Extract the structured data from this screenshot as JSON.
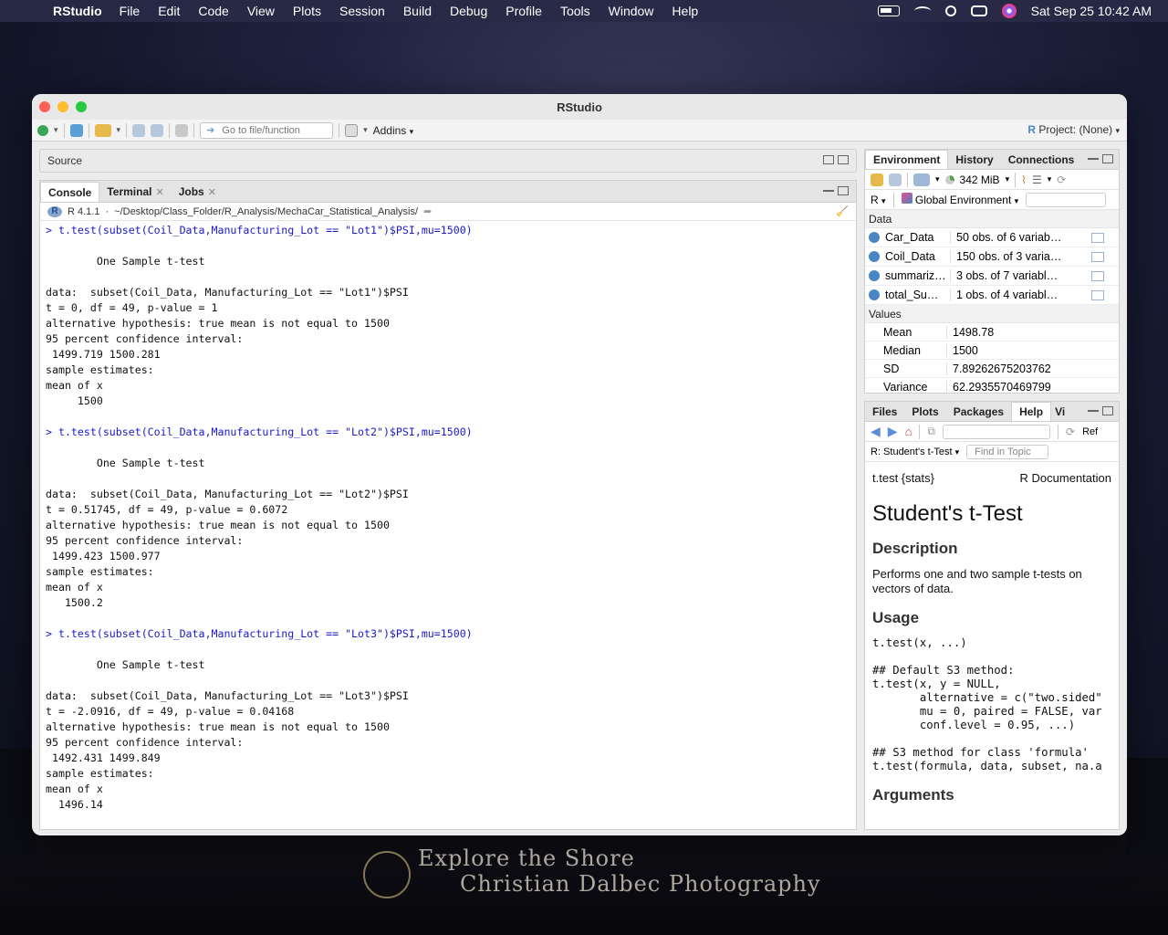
{
  "menubar": {
    "app_name": "RStudio",
    "items": [
      "File",
      "Edit",
      "Code",
      "View",
      "Plots",
      "Session",
      "Build",
      "Debug",
      "Profile",
      "Tools",
      "Window",
      "Help"
    ],
    "datetime": "Sat Sep 25  10:42 AM"
  },
  "window": {
    "title": "RStudio"
  },
  "toolbar": {
    "goto_placeholder": "Go to file/function",
    "addins_label": "Addins",
    "project_label": "Project: (None)"
  },
  "source_pane": {
    "title": "Source"
  },
  "console": {
    "tabs": [
      "Console",
      "Terminal",
      "Jobs"
    ],
    "r_version": "R 4.1.1",
    "path": "~/Desktop/Class_Folder/R_Analysis/MechaCar_Statistical_Analysis/",
    "lines": [
      {
        "t": "cmd",
        "text": "> t.test(subset(Coil_Data,Manufacturing_Lot == \"Lot1\")$PSI,mu=1500)"
      },
      {
        "t": "out",
        "text": ""
      },
      {
        "t": "out",
        "text": "        One Sample t-test"
      },
      {
        "t": "out",
        "text": ""
      },
      {
        "t": "out",
        "text": "data:  subset(Coil_Data, Manufacturing_Lot == \"Lot1\")$PSI"
      },
      {
        "t": "out",
        "text": "t = 0, df = 49, p-value = 1"
      },
      {
        "t": "out",
        "text": "alternative hypothesis: true mean is not equal to 1500"
      },
      {
        "t": "out",
        "text": "95 percent confidence interval:"
      },
      {
        "t": "out",
        "text": " 1499.719 1500.281"
      },
      {
        "t": "out",
        "text": "sample estimates:"
      },
      {
        "t": "out",
        "text": "mean of x"
      },
      {
        "t": "out",
        "text": "     1500"
      },
      {
        "t": "out",
        "text": ""
      },
      {
        "t": "cmd",
        "text": "> t.test(subset(Coil_Data,Manufacturing_Lot == \"Lot2\")$PSI,mu=1500)"
      },
      {
        "t": "out",
        "text": ""
      },
      {
        "t": "out",
        "text": "        One Sample t-test"
      },
      {
        "t": "out",
        "text": ""
      },
      {
        "t": "out",
        "text": "data:  subset(Coil_Data, Manufacturing_Lot == \"Lot2\")$PSI"
      },
      {
        "t": "out",
        "text": "t = 0.51745, df = 49, p-value = 0.6072"
      },
      {
        "t": "out",
        "text": "alternative hypothesis: true mean is not equal to 1500"
      },
      {
        "t": "out",
        "text": "95 percent confidence interval:"
      },
      {
        "t": "out",
        "text": " 1499.423 1500.977"
      },
      {
        "t": "out",
        "text": "sample estimates:"
      },
      {
        "t": "out",
        "text": "mean of x"
      },
      {
        "t": "out",
        "text": "   1500.2"
      },
      {
        "t": "out",
        "text": ""
      },
      {
        "t": "cmd",
        "text": "> t.test(subset(Coil_Data,Manufacturing_Lot == \"Lot3\")$PSI,mu=1500)"
      },
      {
        "t": "out",
        "text": ""
      },
      {
        "t": "out",
        "text": "        One Sample t-test"
      },
      {
        "t": "out",
        "text": ""
      },
      {
        "t": "out",
        "text": "data:  subset(Coil_Data, Manufacturing_Lot == \"Lot3\")$PSI"
      },
      {
        "t": "out",
        "text": "t = -2.0916, df = 49, p-value = 0.04168"
      },
      {
        "t": "out",
        "text": "alternative hypothesis: true mean is not equal to 1500"
      },
      {
        "t": "out",
        "text": "95 percent confidence interval:"
      },
      {
        "t": "out",
        "text": " 1492.431 1499.849"
      },
      {
        "t": "out",
        "text": "sample estimates:"
      },
      {
        "t": "out",
        "text": "mean of x"
      },
      {
        "t": "out",
        "text": "  1496.14"
      }
    ]
  },
  "environment": {
    "tabs": [
      "Environment",
      "History",
      "Connections"
    ],
    "memory": "342 MiB",
    "lang": "R",
    "scope": "Global Environment",
    "data_header": "Data",
    "data": [
      {
        "name": "Car_Data",
        "value": "50 obs. of 6 variab…"
      },
      {
        "name": "Coil_Data",
        "value": "150 obs. of 3 varia…"
      },
      {
        "name": "summariz…",
        "value": "3 obs. of 7 variabl…"
      },
      {
        "name": "total_Su…",
        "value": "1 obs. of 4 variabl…"
      }
    ],
    "values_header": "Values",
    "values": [
      {
        "name": "Mean",
        "value": "1498.78"
      },
      {
        "name": "Median",
        "value": "1500"
      },
      {
        "name": "SD",
        "value": "7.89262675203762"
      },
      {
        "name": "Variance",
        "value": "62.2935570469799"
      }
    ]
  },
  "help": {
    "tabs": [
      "Files",
      "Plots",
      "Packages",
      "Help",
      "Vi"
    ],
    "topic": "R: Student's t-Test",
    "find_placeholder": "Find in Topic",
    "refresh_label": "Ref",
    "pkg": "t.test {stats}",
    "doc": "R Documentation",
    "title": "Student's t-Test",
    "desc_head": "Description",
    "desc": "Performs one and two sample t-tests on vectors of data.",
    "usage_head": "Usage",
    "usage_code": "t.test(x, ...)\n\n## Default S3 method:\nt.test(x, y = NULL,\n       alternative = c(\"two.sided\"\n       mu = 0, paired = FALSE, var\n       conf.level = 0.95, ...)\n\n## S3 method for class 'formula'\nt.test(formula, data, subset, na.a",
    "args_head": "Arguments"
  },
  "watermark": {
    "line1": "Explore the Shore",
    "line2": "Christian Dalbec Photography"
  }
}
